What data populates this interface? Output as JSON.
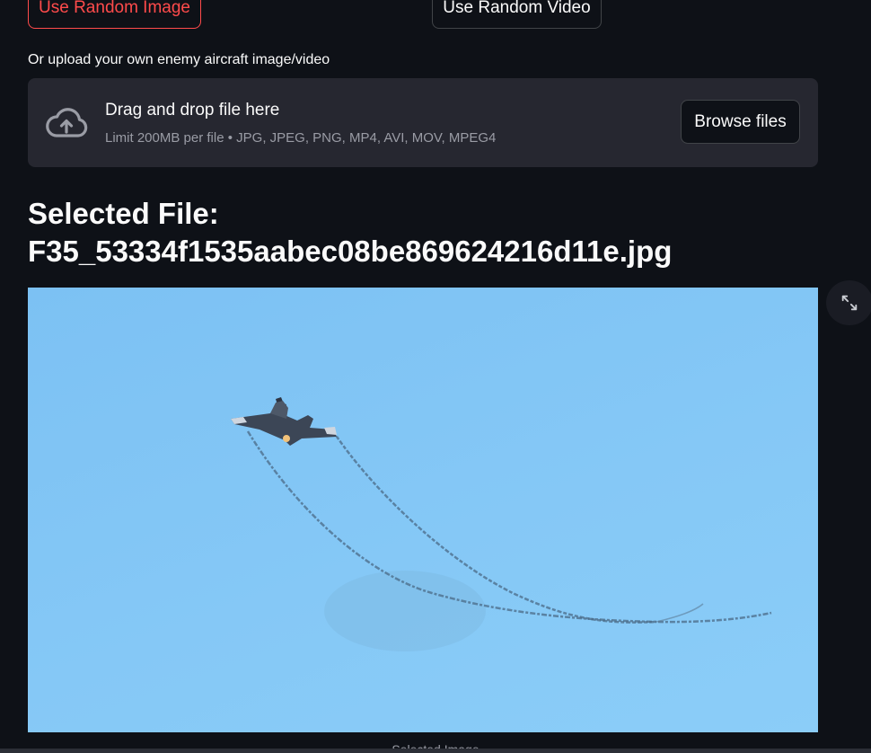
{
  "buttons": {
    "random_image": "Use Random Image",
    "random_video": "Use Random Video"
  },
  "upload": {
    "label": "Or upload your own enemy aircraft image/video",
    "dropzone_title": "Drag and drop file here",
    "dropzone_limit": "Limit 200MB per file • JPG, JPEG, PNG, MP4, AVI, MOV, MPEG4",
    "browse_label": "Browse files",
    "icon": "cloud-upload-icon"
  },
  "selected": {
    "heading": "Selected File:",
    "filename": "F35_53334f1535aabec08be869624216d11e.jpg"
  },
  "image": {
    "alt": "F35_53334f1535aabec08be869624216d11e.jpg",
    "caption": "Selected Image",
    "expand_icon": "fullscreen-expand-icon"
  },
  "colors": {
    "background": "#0e1117",
    "accent": "#ff4b4b",
    "dropzone": "#262730",
    "muted_text": "#9a9ca5",
    "sky": "#85c8f6"
  }
}
